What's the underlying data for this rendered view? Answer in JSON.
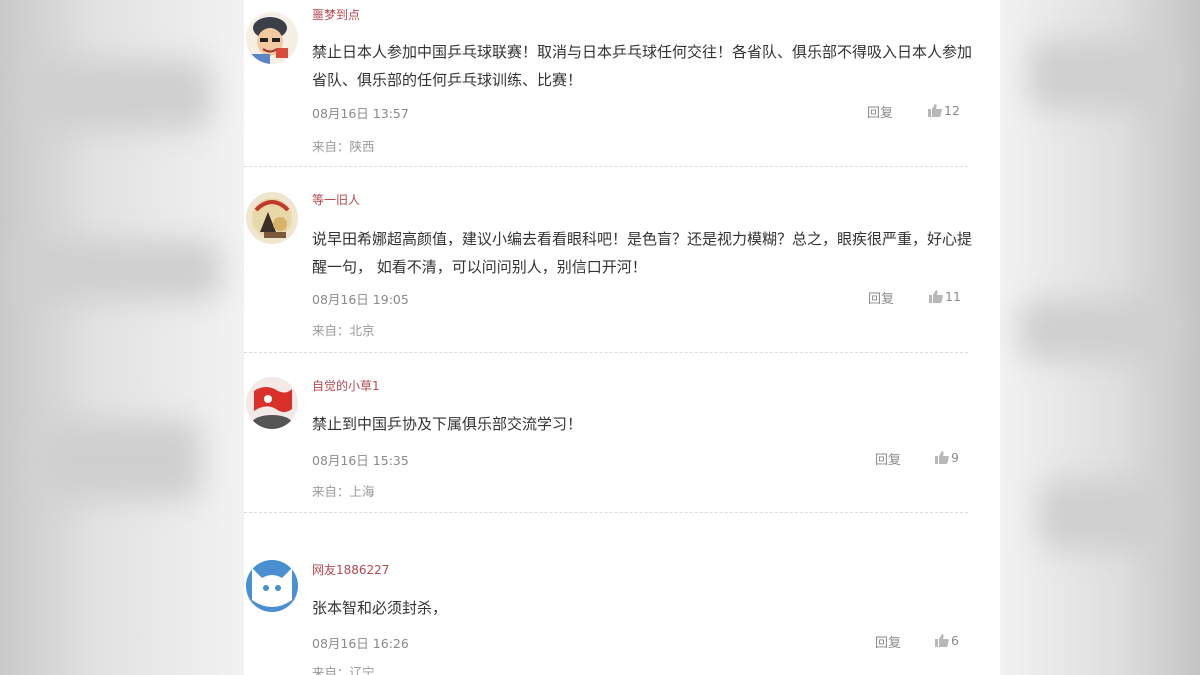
{
  "comments": [
    {
      "username": "噩梦到点",
      "text": "禁止日本人参加中国乒乓球联赛！取消与日本乒乓球任何交往！各省队、俱乐部不得吸入日本人参加省队、俱乐部的任何乒乓球训练、比赛！",
      "time": "08月16日 13:57",
      "reply_label": "回复",
      "likes": "12",
      "source": "来自：陕西"
    },
    {
      "username": "等一旧人",
      "text": "说早田希娜超高颜值，建议小编去看看眼科吧！是色盲？还是视力模糊？总之，眼疾很严重，好心提醒一句， 如看不清，可以问问别人，别信口开河！",
      "time": "08月16日 19:05",
      "reply_label": "回复",
      "likes": "11",
      "source": "来自：北京"
    },
    {
      "username": "自觉的小草1",
      "text": "禁止到中国乒协及下属俱乐部交流学习！",
      "time": "08月16日 15:35",
      "reply_label": "回复",
      "likes": "9",
      "source": "来自：上海"
    },
    {
      "username": "网友1886227",
      "text": "张本智和必须封杀，",
      "time": "08月16日 16:26",
      "reply_label": "回复",
      "likes": "6",
      "source": "来自：辽宁"
    }
  ],
  "colors": {
    "username": "#b5474f",
    "meta": "#8a8a8a",
    "body_text": "#333333"
  },
  "icons": {
    "like": "thumbs-up-icon"
  }
}
